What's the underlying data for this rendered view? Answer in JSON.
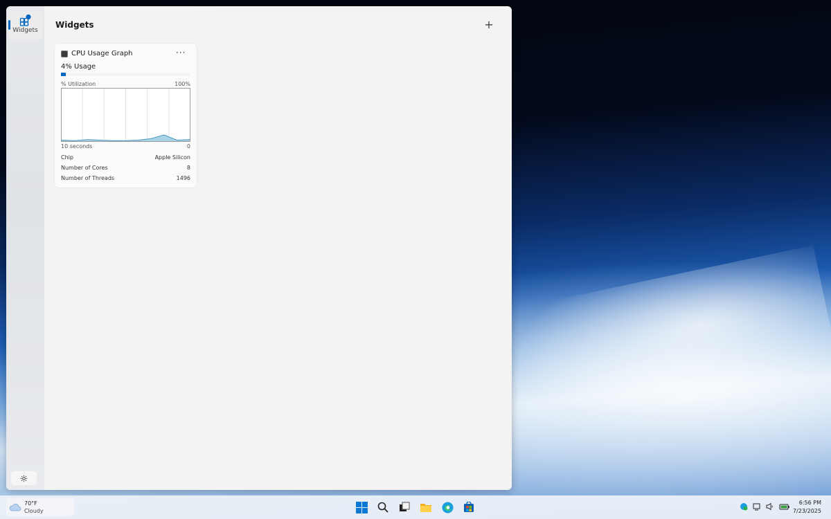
{
  "sidebar": {
    "nav_label": "Widgets"
  },
  "main": {
    "title": "Widgets",
    "add_label": "+"
  },
  "card": {
    "title": "CPU Usage Graph",
    "more_label": "···",
    "usage_text": "4% Usage",
    "usage_percent": 4,
    "util_label": "% Utilization",
    "util_max": "100%",
    "axis_left": "10 seconds",
    "axis_right": "0",
    "graph_values": [
      2,
      1,
      3,
      2,
      1,
      1,
      2,
      5,
      12,
      2,
      3
    ],
    "rows": [
      {
        "label": "Chip",
        "value": "Apple Silicon"
      },
      {
        "label": "Number of Cores",
        "value": "8"
      },
      {
        "label": "Number of Threads",
        "value": "1496"
      }
    ]
  },
  "taskbar": {
    "weather": {
      "temp": "70°F",
      "condition": "Cloudy"
    },
    "clock": {
      "time": "6:56 PM",
      "date": "7/23/2025"
    }
  },
  "colors": {
    "accent": "#0067c0"
  }
}
